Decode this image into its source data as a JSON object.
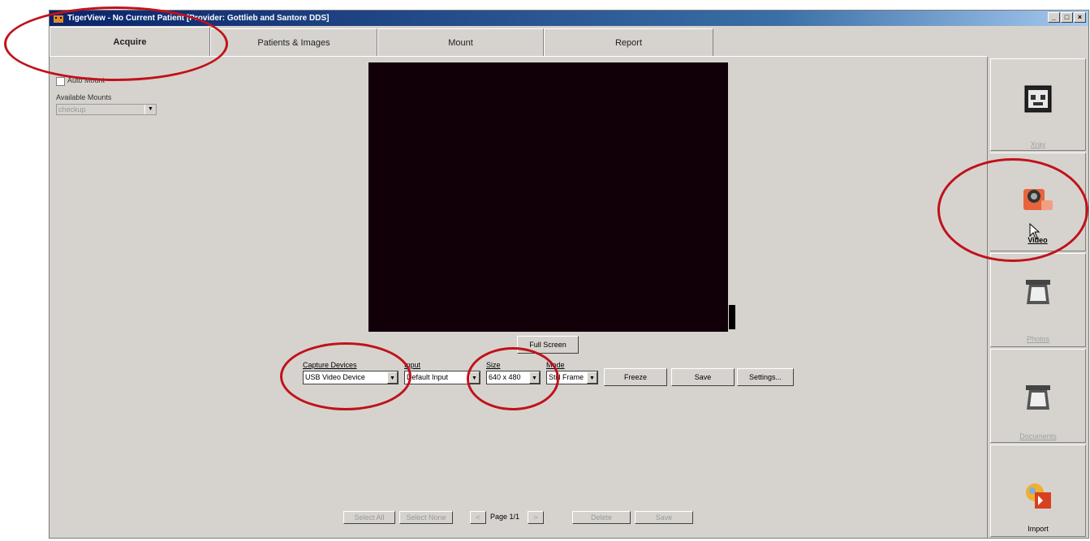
{
  "window": {
    "title": "TigerView - No Current Patient [Provider: Gottlieb and Santore DDS]",
    "controls": [
      "_",
      "□",
      "×"
    ]
  },
  "tabs": [
    {
      "label": "Acquire",
      "active": true
    },
    {
      "label": "Patients & Images",
      "active": false
    },
    {
      "label": "Mount",
      "active": false
    },
    {
      "label": "Report",
      "active": false
    }
  ],
  "left_panel": {
    "auto_mount_label": "Auto Mount",
    "available_mounts_label": "Available Mounts",
    "mount_select_value": "checkup"
  },
  "capture": {
    "full_screen_label": "Full Screen",
    "devices_label": "Capture Devices",
    "devices_value": "USB Video Device",
    "input_label": "Input",
    "input_value": "Default Input",
    "size_label": "Size",
    "size_value": "640 x 480",
    "mode_label": "Mode",
    "mode_value": "Still Frame",
    "freeze_label": "Freeze",
    "save_label": "Save",
    "settings_label": "Settings..."
  },
  "sidebar": {
    "items": [
      {
        "label": "Xray",
        "icon": "xray-film-icon",
        "active": false
      },
      {
        "label": "Video",
        "icon": "video-camera-icon",
        "active": true
      },
      {
        "label": "Photos",
        "icon": "photo-scanner-icon",
        "active": false
      },
      {
        "label": "Documents",
        "icon": "document-scanner-icon",
        "active": false
      },
      {
        "label": "Import",
        "icon": "import-icon",
        "active": false
      }
    ]
  },
  "pager": {
    "select_all": "Select All",
    "select_none": "Select None",
    "prev": "<",
    "page_text": "Page 1/1",
    "next": ">",
    "delete": "Delete",
    "save": "Save"
  },
  "colors": {
    "annotation_circle": "#c0121b",
    "preview_background": "#110008",
    "window_background": "#d6d3ce"
  }
}
